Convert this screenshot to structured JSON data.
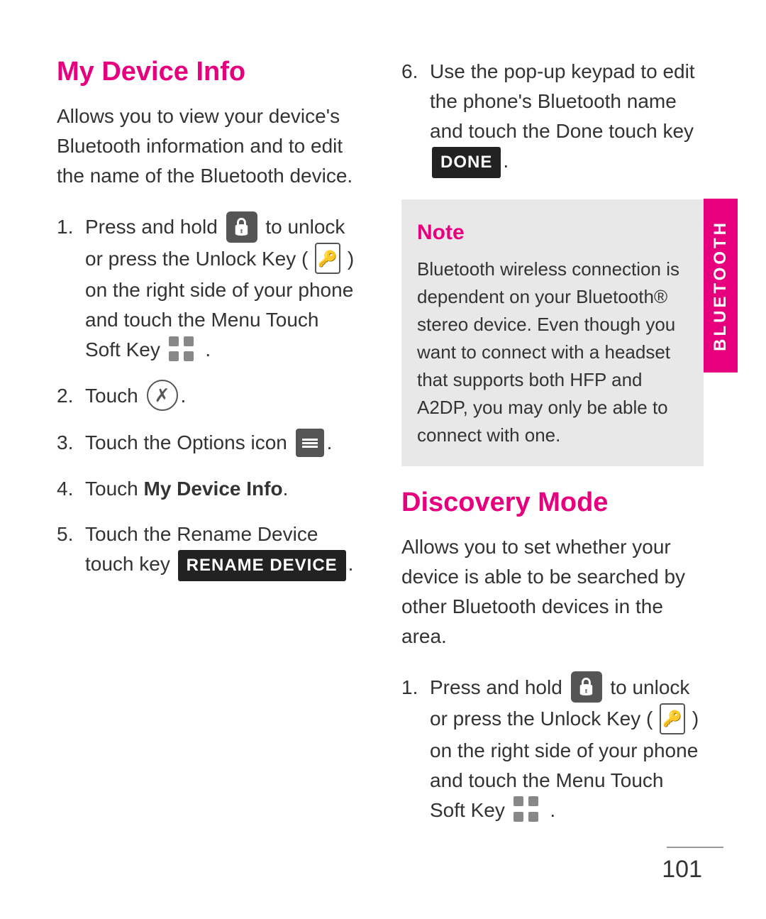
{
  "left_section": {
    "title": "My Device Info",
    "description": "Allows you to view your device's Bluetooth information and to edit the name of the Bluetooth device.",
    "steps": [
      {
        "number": "1.",
        "text_before_icon1": "Press and hold ",
        "text_after_icon1": " to unlock or press the Unlock Key ( ",
        "text_after_icon2": " ) on the right side of your phone and touch the Menu Touch Soft Key ",
        "text_end": " ."
      },
      {
        "number": "2.",
        "text": "Touch ",
        "text_end": "."
      },
      {
        "number": "3.",
        "text": "Touch the Options icon ",
        "text_end": "."
      },
      {
        "number": "4.",
        "text_before": "Touch ",
        "bold_text": "My Device Info",
        "text_after": "."
      },
      {
        "number": "5.",
        "text_before": "Touch the Rename Device touch key ",
        "btn_label": "RENAME DEVICE",
        "text_after": "."
      }
    ]
  },
  "right_section": {
    "step6": {
      "text": "Use the pop-up keypad to edit the phone's Bluetooth name and touch the Done touch key ",
      "btn_label": "DONE",
      "text_end": "."
    },
    "note": {
      "title": "Note",
      "text": "Bluetooth wireless connection is dependent on your Bluetooth® stereo device. Even though you want to connect with a headset that supports both HFP and A2DP, you may only be able to connect with one."
    },
    "discovery_title": "Discovery Mode",
    "discovery_desc": "Allows you to set whether your device is able to be searched by other Bluetooth devices in the area.",
    "step1": {
      "number": "1.",
      "text_before_icon1": "Press and hold ",
      "text_after_icon1": " to unlock or press the Unlock Key ( ",
      "text_after_icon2": " ) on the right side of your phone and touch the Menu Touch Soft Key ",
      "text_end": " ."
    }
  },
  "sidebar": {
    "label": "BLUETOOTH"
  },
  "page_number": "101"
}
